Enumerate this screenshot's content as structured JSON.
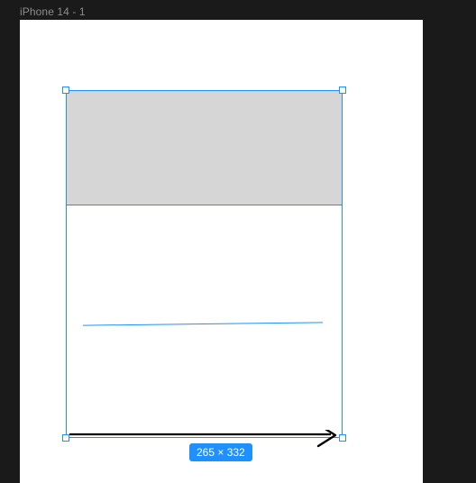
{
  "frame": {
    "label": "iPhone 14 - 1"
  },
  "selection": {
    "size_label": "265 × 332"
  }
}
